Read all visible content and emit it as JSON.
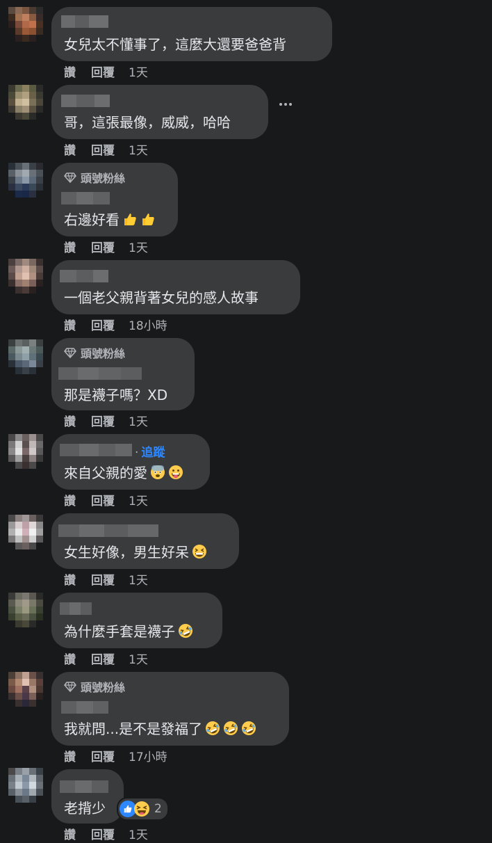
{
  "actions": {
    "like_label": "讚",
    "reply_label": "回覆"
  },
  "badge_label": "頭號粉絲",
  "follow_label": "追蹤",
  "follow_dot": "·",
  "comments": [
    {
      "text": "女兒太不懂事了，這麼大還要爸爸背",
      "time": "1天"
    },
    {
      "text": "哥，這張最像，威威，哈哈",
      "time": "1天"
    },
    {
      "text": "右邊好看",
      "time": "1天"
    },
    {
      "text": "一個老父親背著女兒的感人故事",
      "time": "18小時"
    },
    {
      "text": "那是襪子嗎？XD",
      "time": "1天"
    },
    {
      "text": "來自父親的愛",
      "time": "1天"
    },
    {
      "text": "女生好像，男生好呆",
      "time": "1天"
    },
    {
      "text": "為什麼手套是襪子",
      "time": "1天"
    },
    {
      "text": "我就問...是不是發福了",
      "time": "17小時"
    },
    {
      "text": "老揹少",
      "time": "1天"
    }
  ],
  "reaction_count": "2",
  "icons": {
    "more": "more-options-icon",
    "badge": "diamond-icon",
    "thumbs_up": "thumbs-up-emoji",
    "laugh": "rofl-emoji",
    "grin": "grinning-squint-emoji",
    "tongue": "tongue-emoji",
    "anxious": "anxious-face-emoji"
  },
  "colors": {
    "background": "#18191a",
    "bubble": "#3a3b3c",
    "text": "#e4e6eb",
    "secondary": "#b0b3b8",
    "link": "#2d88ff"
  }
}
